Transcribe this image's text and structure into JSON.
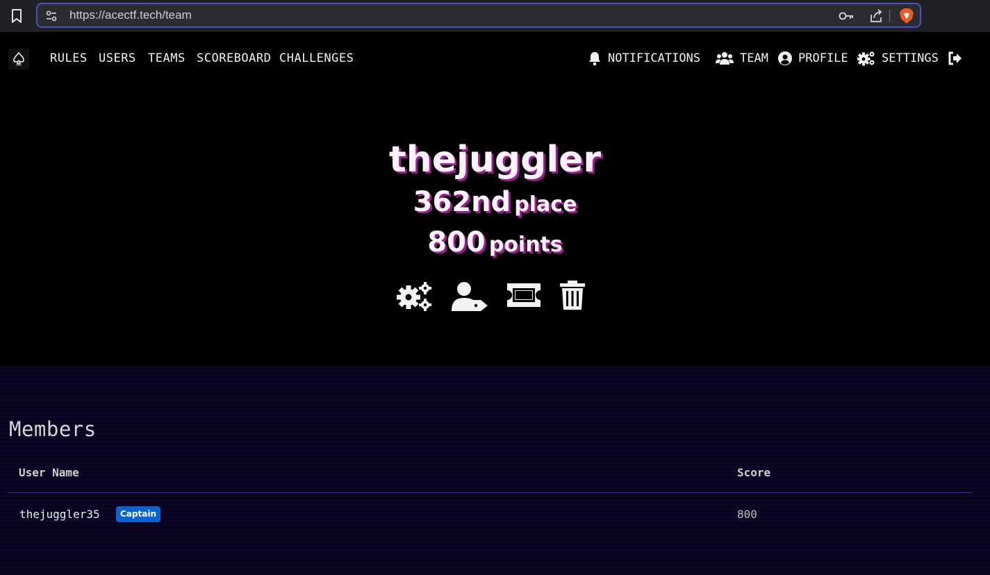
{
  "browser": {
    "url": "https://acectf.tech/team"
  },
  "nav": {
    "left_links": [
      "RULES",
      "USERS",
      "TEAMS",
      "SCOREBOARD",
      "CHALLENGES"
    ],
    "notifications_label": "NOTIFICATIONS",
    "team_label": "TEAM",
    "profile_label": "PROFILE",
    "settings_label": "SETTINGS"
  },
  "team": {
    "name": "thejuggler",
    "place_value": "362nd",
    "place_unit": "place",
    "points_value": "800",
    "points_unit": "points",
    "actions": [
      "gears-icon",
      "user-tag-icon",
      "ticket-icon",
      "trash-icon"
    ]
  },
  "members": {
    "title": "Members",
    "columns": [
      "User Name",
      "Score"
    ],
    "rows": [
      {
        "user": "thejuggler35",
        "badge": "Captain",
        "score": "800"
      }
    ]
  },
  "colors": {
    "accent_shadow": "#9b1c8f",
    "badge": "#0a63d2",
    "url_border": "#4a52c8",
    "members_bg": "#0d0628"
  }
}
